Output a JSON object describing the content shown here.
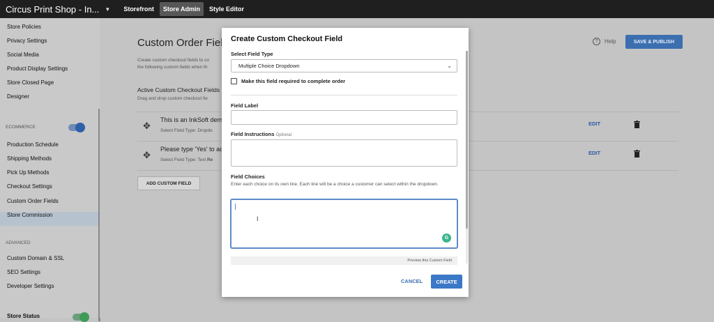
{
  "topbar": {
    "shop_title": "Circus Print Shop - In...",
    "caret_icon": "caret-down-icon",
    "nav": [
      "Storefront",
      "Store Admin",
      "Style Editor"
    ],
    "active_nav": "Store Admin"
  },
  "sidebar": {
    "items_top": [
      "Store Policies",
      "Privacy Settings",
      "Social Media",
      "Product Display Settings",
      "Store Closed Page",
      "Designer"
    ],
    "section_ecommerce": "ECOMMERCE",
    "items_ecommerce": [
      "Production Schedule",
      "Shipping Methods",
      "Pick Up Methods",
      "Checkout Settings",
      "Custom Order Fields",
      "Store Commission"
    ],
    "active_item": "Custom Order Fields",
    "section_advanced": "ADVANCED",
    "items_advanced": [
      "Custom Domain & SSL",
      "SEO Settings",
      "Developer Settings"
    ],
    "store_status": "Store Status"
  },
  "main": {
    "title": "Custom Order Fields",
    "desc_line1": "Create custom checkout fields to co",
    "desc_line2": "the following custom fields when th",
    "active_title": "Active Custom Checkout Fields",
    "active_desc": "Drag and drop custom checkout fie",
    "rows": [
      {
        "title": "This is an InkSoft dem",
        "sub": "Select Field Type: Dropdo",
        "edit": "EDIT"
      },
      {
        "title": "Please type 'Yes' to ac",
        "sub": "Select Field Type: Text",
        "sub_extra": "Re",
        "edit": "EDIT"
      }
    ],
    "add_button": "ADD CUSTOM FIELD",
    "help": "Help",
    "save_publish": "SAVE & PUBLISH"
  },
  "modal": {
    "title": "Create Custom Checkout Field",
    "select_field_type_label": "Select Field Type",
    "select_field_type_value": "Multiple Choice Dropdown",
    "required_label": "Make this field required to complete order",
    "required_checked": false,
    "field_label_label": "Field Label",
    "field_label_value": "",
    "field_instructions_label": "Field Instructions",
    "field_instructions_optional": "Optional",
    "field_instructions_value": "",
    "field_choices_label": "Field Choices",
    "field_choices_help": "Enter each choice on its own line. Each line will be a choice a customer can select within the dropdown.",
    "field_choices_value": "",
    "grammarly_glyph": "G",
    "preview": "Preview this Custom Field",
    "cancel": "CANCEL",
    "create": "CREATE"
  },
  "colors": {
    "accent": "#3b78c7",
    "topbar": "#1f1f1f",
    "toggle_on": "#2f5fa8",
    "status_green": "#3f9c57"
  }
}
